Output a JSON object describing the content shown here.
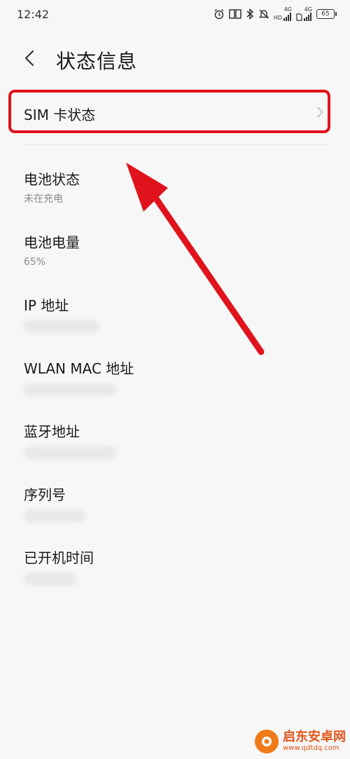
{
  "status_bar": {
    "time": "12:42",
    "net_label_1": "4G",
    "hd_label": "HD",
    "net_label_2": "4G",
    "battery": "65"
  },
  "header": {
    "title": "状态信息",
    "back_icon": "chevron-left-icon"
  },
  "sim": {
    "label": "SIM 卡状态",
    "chevron_icon": "chevron-right-icon"
  },
  "items": [
    {
      "label": "电池状态",
      "value": "未在充电"
    },
    {
      "label": "电池电量",
      "value": "65%"
    },
    {
      "label": "IP 地址"
    },
    {
      "label": "WLAN MAC 地址"
    },
    {
      "label": "蓝牙地址"
    },
    {
      "label": "序列号"
    },
    {
      "label": "已开机时间"
    }
  ],
  "colors": {
    "highlight": "#e0131c",
    "background": "#f7f7f7",
    "watermark": "#e0551a"
  },
  "watermark": {
    "name": "启东安卓网",
    "url": "www.qdtdq.com"
  }
}
